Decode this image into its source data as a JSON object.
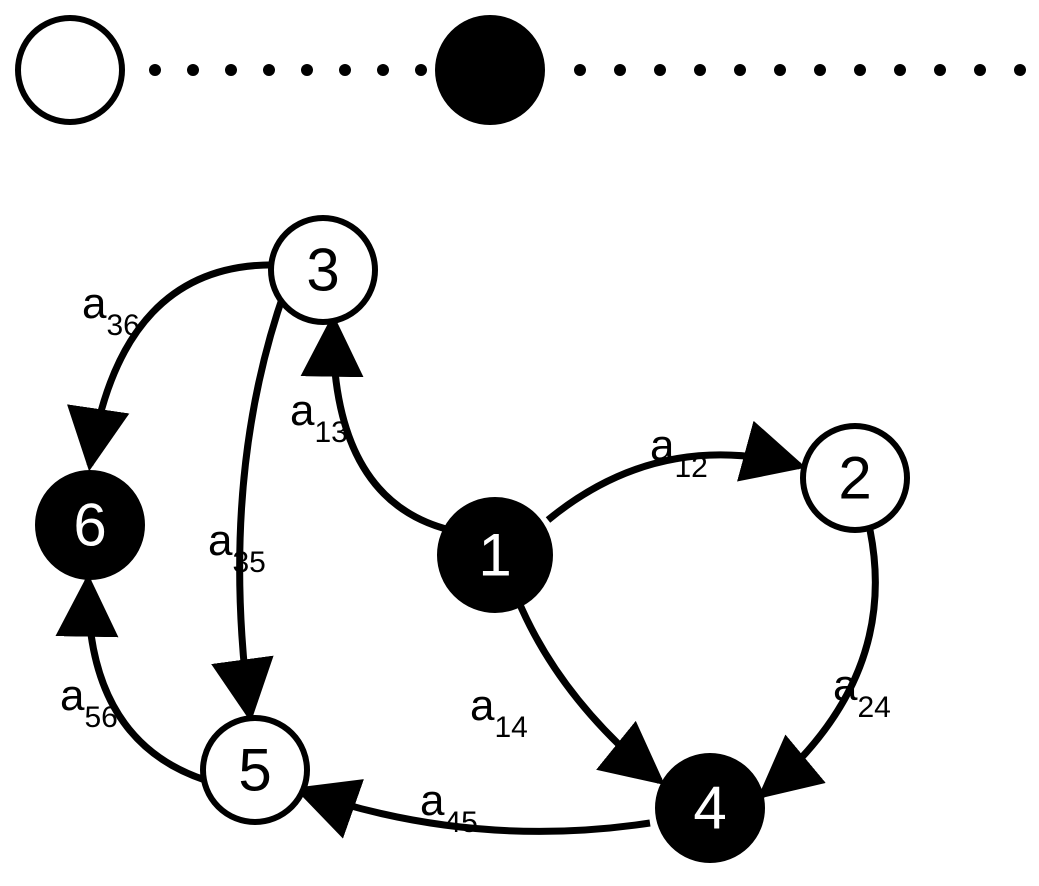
{
  "legend": {
    "left_node_fill": "white",
    "right_node_fill": "black"
  },
  "nodes": {
    "n1": {
      "label": "1",
      "fill": "black",
      "text": "white"
    },
    "n2": {
      "label": "2",
      "fill": "white",
      "text": "black"
    },
    "n3": {
      "label": "3",
      "fill": "white",
      "text": "black"
    },
    "n4": {
      "label": "4",
      "fill": "black",
      "text": "white"
    },
    "n5": {
      "label": "5",
      "fill": "white",
      "text": "black"
    },
    "n6": {
      "label": "6",
      "fill": "black",
      "text": "white"
    }
  },
  "edges": {
    "a12": {
      "from": "1",
      "to": "2",
      "prefix": "a",
      "sub": "12"
    },
    "a13": {
      "from": "1",
      "to": "3",
      "prefix": "a",
      "sub": "13"
    },
    "a14": {
      "from": "1",
      "to": "4",
      "prefix": "a",
      "sub": "14"
    },
    "a24": {
      "from": "2",
      "to": "4",
      "prefix": "a",
      "sub": "24"
    },
    "a35": {
      "from": "3",
      "to": "5",
      "prefix": "a",
      "sub": "35"
    },
    "a36": {
      "from": "3",
      "to": "6",
      "prefix": "a",
      "sub": "36"
    },
    "a45": {
      "from": "4",
      "to": "5",
      "prefix": "a",
      "sub": "45"
    },
    "a56": {
      "from": "5",
      "to": "6",
      "prefix": "a",
      "sub": "56"
    }
  }
}
